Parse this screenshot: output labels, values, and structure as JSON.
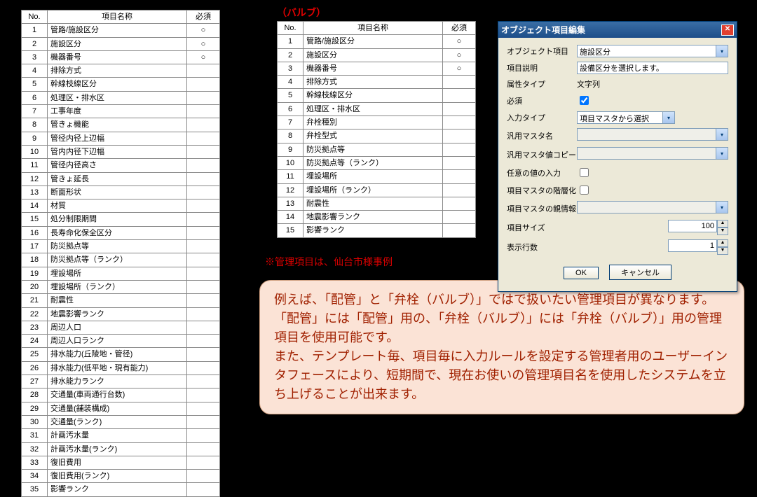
{
  "table_headers": {
    "no": "No.",
    "name": "項目名称",
    "req": "必須"
  },
  "mark": "○",
  "table_left": [
    {
      "no": 1,
      "name": "管路/施設区分",
      "req": true
    },
    {
      "no": 2,
      "name": "施設区分",
      "req": true
    },
    {
      "no": 3,
      "name": "機器番号",
      "req": true
    },
    {
      "no": 4,
      "name": "排除方式",
      "req": false
    },
    {
      "no": 5,
      "name": "幹線枝線区分",
      "req": false
    },
    {
      "no": 6,
      "name": "処理区・排水区",
      "req": false
    },
    {
      "no": 7,
      "name": "工事年度",
      "req": false
    },
    {
      "no": 8,
      "name": "管きょ機能",
      "req": false
    },
    {
      "no": 9,
      "name": "管径内径上辺幅",
      "req": false
    },
    {
      "no": 10,
      "name": "管内内径下辺幅",
      "req": false
    },
    {
      "no": 11,
      "name": "管径内径高さ",
      "req": false
    },
    {
      "no": 12,
      "name": "管きょ延長",
      "req": false
    },
    {
      "no": 13,
      "name": "断面形状",
      "req": false
    },
    {
      "no": 14,
      "name": "材質",
      "req": false
    },
    {
      "no": 15,
      "name": "処分制限期間",
      "req": false
    },
    {
      "no": 16,
      "name": "長寿命化保全区分",
      "req": false
    },
    {
      "no": 17,
      "name": "防災拠点等",
      "req": false
    },
    {
      "no": 18,
      "name": "防災拠点等（ランク）",
      "req": false
    },
    {
      "no": 19,
      "name": "埋設場所",
      "req": false
    },
    {
      "no": 20,
      "name": "埋設場所（ランク）",
      "req": false
    },
    {
      "no": 21,
      "name": "耐震性",
      "req": false
    },
    {
      "no": 22,
      "name": "地震影響ランク",
      "req": false
    },
    {
      "no": 23,
      "name": "周辺人口",
      "req": false
    },
    {
      "no": 24,
      "name": "周辺人口ランク",
      "req": false
    },
    {
      "no": 25,
      "name": "排水能力(丘陵地・管径)",
      "req": false
    },
    {
      "no": 26,
      "name": "排水能力(低平地・現有能力)",
      "req": false
    },
    {
      "no": 27,
      "name": "排水能力ランク",
      "req": false
    },
    {
      "no": 28,
      "name": "交通量(車両通行台数)",
      "req": false
    },
    {
      "no": 29,
      "name": "交通量(舗装構成)",
      "req": false
    },
    {
      "no": 30,
      "name": "交通量(ランク)",
      "req": false
    },
    {
      "no": 31,
      "name": "計画汚水量",
      "req": false
    },
    {
      "no": 32,
      "name": "計画汚水量(ランク)",
      "req": false
    },
    {
      "no": 33,
      "name": "復旧費用",
      "req": false
    },
    {
      "no": 34,
      "name": "復旧費用(ランク)",
      "req": false
    },
    {
      "no": 35,
      "name": "影響ランク",
      "req": false
    }
  ],
  "table_right": [
    {
      "no": 1,
      "name": "管路/施設区分",
      "req": true
    },
    {
      "no": 2,
      "name": "施設区分",
      "req": true
    },
    {
      "no": 3,
      "name": "機器番号",
      "req": true
    },
    {
      "no": 4,
      "name": "排除方式",
      "req": false
    },
    {
      "no": 5,
      "name": "幹線枝線区分",
      "req": false
    },
    {
      "no": 6,
      "name": "処理区・排水区",
      "req": false
    },
    {
      "no": 7,
      "name": "弁栓種別",
      "req": false
    },
    {
      "no": 8,
      "name": "弁栓型式",
      "req": false
    },
    {
      "no": 9,
      "name": "防災拠点等",
      "req": false
    },
    {
      "no": 10,
      "name": "防災拠点等（ランク）",
      "req": false
    },
    {
      "no": 11,
      "name": "埋設場所",
      "req": false
    },
    {
      "no": 12,
      "name": "埋設場所（ランク）",
      "req": false
    },
    {
      "no": 13,
      "name": "耐震性",
      "req": false
    },
    {
      "no": 14,
      "name": "地震影響ランク",
      "req": false
    },
    {
      "no": 15,
      "name": "影響ランク",
      "req": false
    }
  ],
  "label_valve": "（バルブ）",
  "label_note": "※管理項目は、仙台市様事例",
  "textbox_lines": [
    "例えば、「配管」と「弁栓（バルブ）」ではで扱いたい管理項目が異なります。",
    "「配管」には「配管」用の、「弁栓（バルブ）」には「弁栓（バルブ）」用の管理項目を使用可能です。",
    "また、テンプレート毎、項目毎に入力ルールを設定する管理者用のユーザーインタフェースにより、短期間で、現在お使いの管理項目名を使用したシステムを立ち上げることが出来ます。"
  ],
  "dialog": {
    "title": "オブジェクト項目編集",
    "fields": {
      "object_item": {
        "label": "オブジェクト項目",
        "value": "施設区分"
      },
      "description": {
        "label": "項目説明",
        "value": "設備区分を選択します。"
      },
      "attr_type": {
        "label": "属性タイプ",
        "value": "文字列"
      },
      "required": {
        "label": "必須",
        "value": true
      },
      "input_type": {
        "label": "入力タイプ",
        "value": "項目マスタから選択"
      },
      "gp_master_name": {
        "label": "汎用マスタ名",
        "value": ""
      },
      "gp_master_copy": {
        "label": "汎用マスタ値コピー",
        "value": ""
      },
      "arbitrary": {
        "label": "任意の値の入力",
        "value": false
      },
      "hier": {
        "label": "項目マスタの階層化",
        "value": false
      },
      "parent": {
        "label": "項目マスタの親情報",
        "value": ""
      },
      "size": {
        "label": "項目サイズ",
        "value": 100
      },
      "rows": {
        "label": "表示行数",
        "value": 1
      }
    },
    "buttons": {
      "ok": "OK",
      "cancel": "キャンセル"
    }
  }
}
